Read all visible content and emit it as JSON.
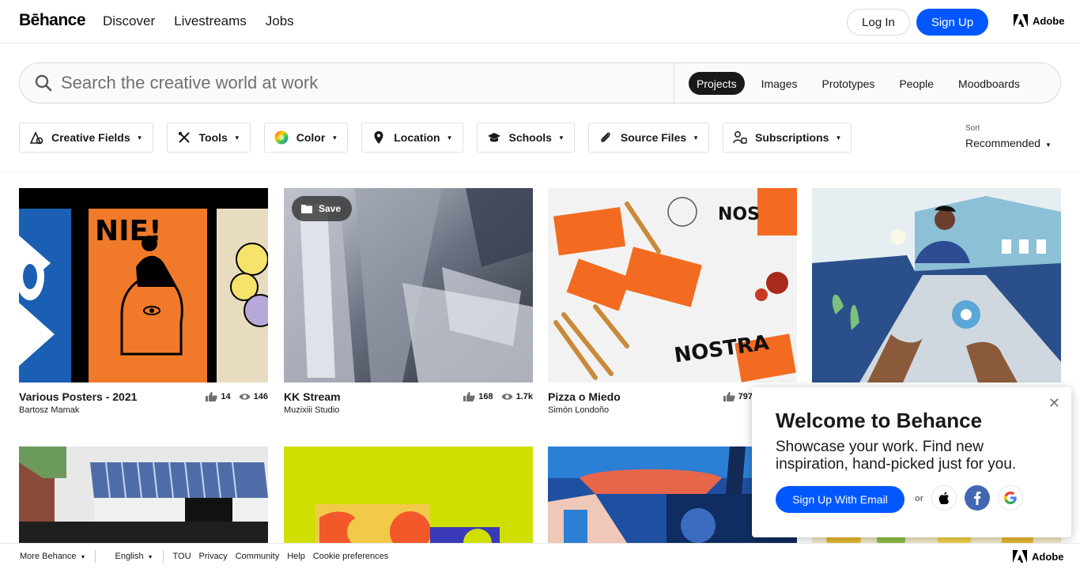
{
  "header": {
    "logo": "Bēhance",
    "nav": [
      "Discover",
      "Livestreams",
      "Jobs"
    ],
    "login_label": "Log In",
    "signup_label": "Sign Up",
    "adobe_label": "Adobe"
  },
  "search": {
    "placeholder": "Search the creative world at work",
    "tabs": [
      "Projects",
      "Images",
      "Prototypes",
      "People",
      "Moodboards"
    ],
    "active_tab": "Projects"
  },
  "filters": {
    "items": [
      "Creative Fields",
      "Tools",
      "Color",
      "Location",
      "Schools",
      "Source Files",
      "Subscriptions"
    ],
    "sort_label": "Sort",
    "sort_value": "Recommended"
  },
  "projects": [
    {
      "title": "Various Posters - 2021",
      "owner": "Bartosz Mamak",
      "likes": "14",
      "views": "146"
    },
    {
      "title": "KK Stream",
      "owner": "Muzixiii Studio",
      "likes": "168",
      "views": "1.7k",
      "save_label": "Save"
    },
    {
      "title": "Pizza o Miedo",
      "owner": "Simón Londoño",
      "likes": "797",
      "views": ""
    },
    {
      "title": "",
      "owner": "",
      "likes": "",
      "views": ""
    }
  ],
  "popup": {
    "title": "Welcome to Behance",
    "body": "Showcase your work. Find new inspiration, hand-picked just for you.",
    "email_button": "Sign Up With Email",
    "or_label": "or"
  },
  "footer": {
    "more": "More Behance",
    "language": "English",
    "links": [
      "TOU",
      "Privacy",
      "Community",
      "Help",
      "Cookie preferences"
    ],
    "adobe_label": "Adobe"
  },
  "colors": {
    "brand_blue": "#0057ff",
    "facebook_blue": "#4267b2"
  }
}
